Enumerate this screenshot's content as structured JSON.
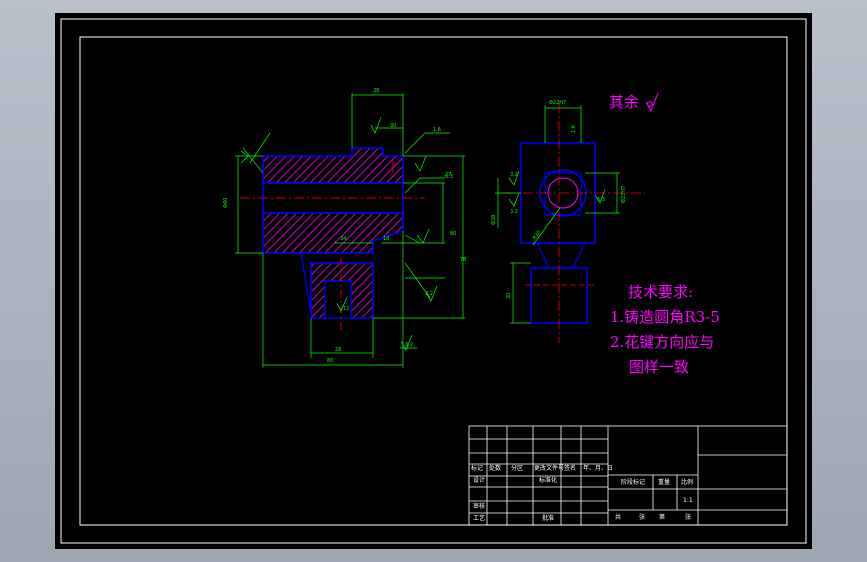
{
  "colors": {
    "background": "#000000",
    "border": "#ffffff",
    "part_outline": "#0000ff",
    "hatch": "#ff00ff",
    "centerline": "#ff0000",
    "dimension": "#00ff00",
    "annotation_text": "#ff00ff"
  },
  "notes": {
    "roughness_other": "其余",
    "tech_requirements_title": "技术要求:",
    "item1": "1.铸造圆角R3-5",
    "item2_line1": "2.花键方向应与",
    "item2_line2": "图样一致"
  },
  "title_block": {
    "row_headers": [
      "标记",
      "处数",
      "分区",
      "更改文件号",
      "签名",
      "年、月、日"
    ],
    "design": "设计",
    "standardization": "标准化",
    "review": "审核",
    "process": "工艺",
    "approve": "批准",
    "stage_mark": "阶段标记",
    "weight": "重量",
    "scale": "比例",
    "scale_value": "1:1",
    "sheets_total": "共",
    "sheets_label": "张",
    "sheet_no": "第",
    "sheet_label": "张"
  }
}
